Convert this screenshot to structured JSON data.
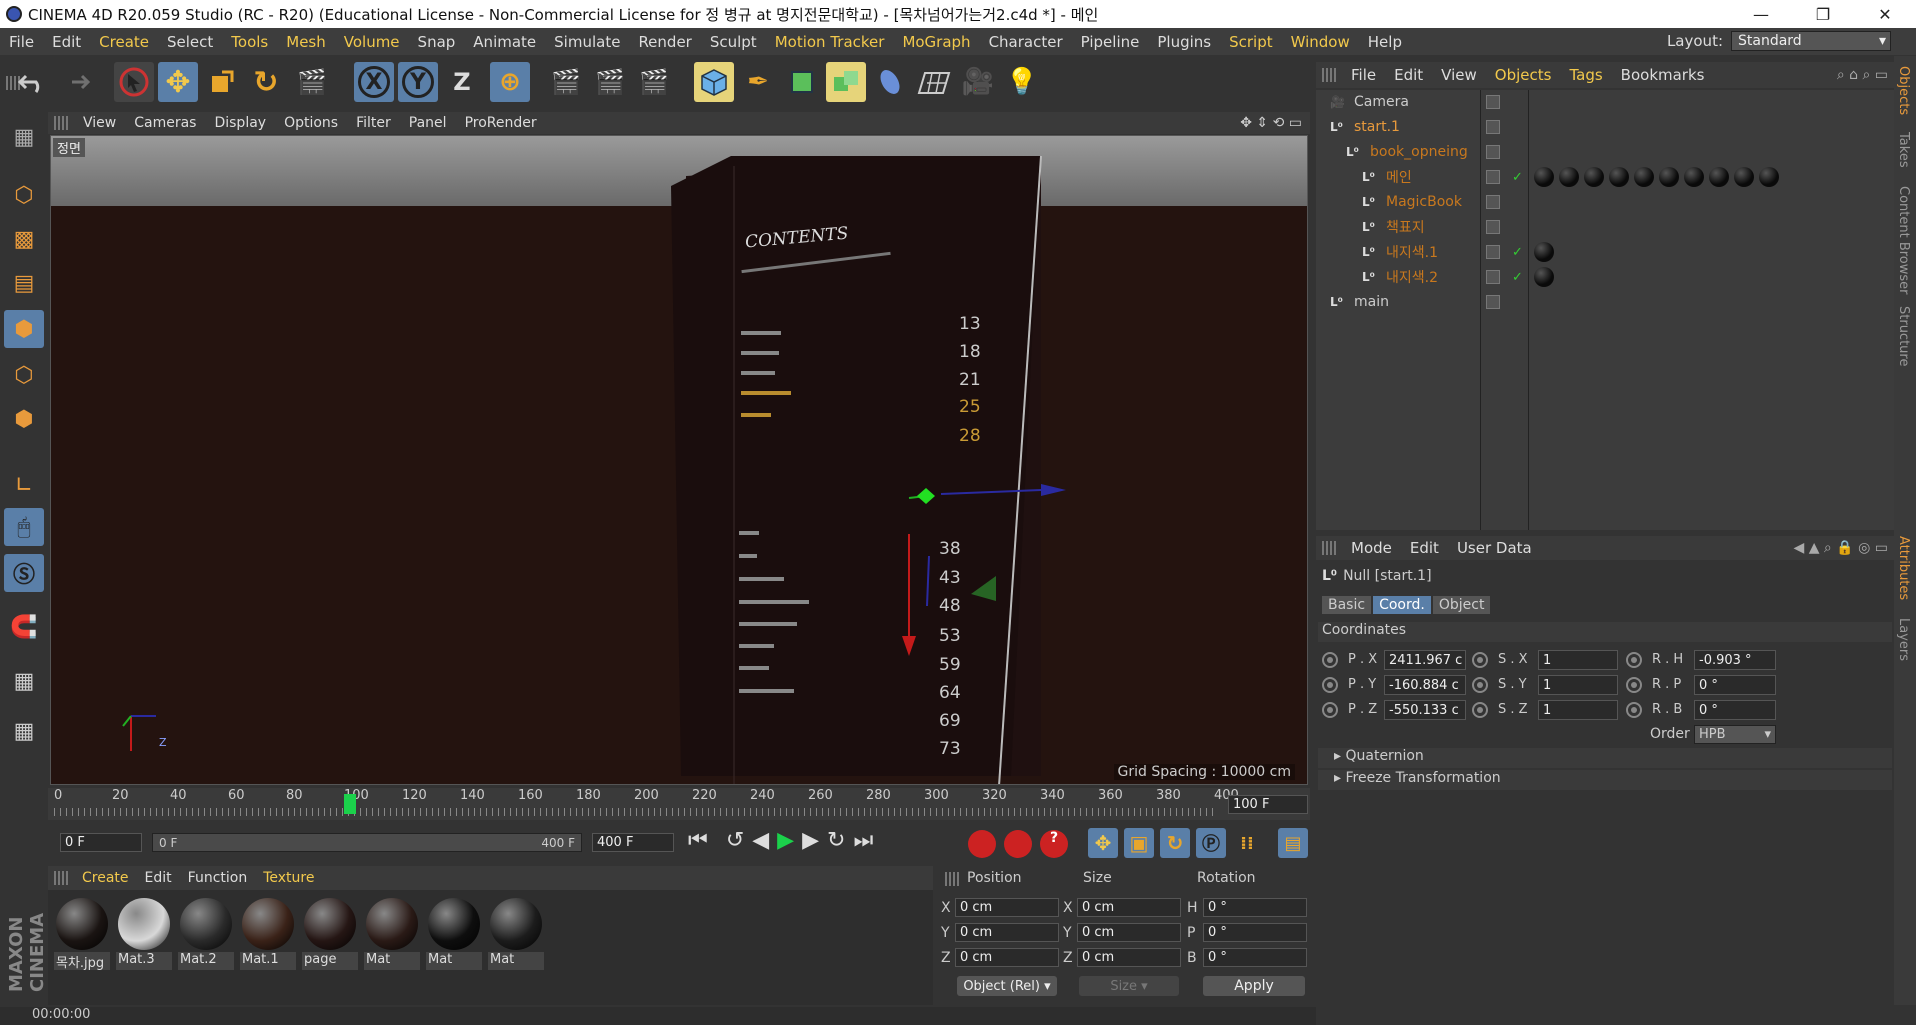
{
  "window": {
    "title": "CINEMA 4D R20.059 Studio (RC - R20) (Educational License - Non-Commercial License for 정 병규 at 명지전문대학교) - [목차넘어가는거2.c4d *] - 메인",
    "min": "—",
    "restore": "❐",
    "close": "✕"
  },
  "menu": {
    "items": [
      "File",
      "Edit",
      "Create",
      "Select",
      "Tools",
      "Mesh",
      "Volume",
      "Snap",
      "Animate",
      "Simulate",
      "Render",
      "Sculpt",
      "Motion Tracker",
      "MoGraph",
      "Character",
      "Pipeline",
      "Plugins",
      "Script",
      "Window",
      "Help"
    ],
    "layout_label": "Layout:",
    "layout_value": "Standard"
  },
  "toolbar": {
    "x": "X",
    "y": "Y",
    "z": "Z"
  },
  "viewport": {
    "menu": [
      "View",
      "Cameras",
      "Display",
      "Options",
      "Filter",
      "Panel",
      "ProRender"
    ],
    "camera_label": "정면",
    "grid_spacing": "Grid Spacing : 10000 cm",
    "book_title": "CONTENTS",
    "page_numbers": [
      "13",
      "18",
      "21",
      "25",
      "28",
      "38",
      "43",
      "48",
      "53",
      "59",
      "64",
      "69",
      "73"
    ],
    "axis_z": "Z"
  },
  "timeline": {
    "ticks": [
      "0",
      "20",
      "40",
      "60",
      "80",
      "100",
      "120",
      "140",
      "160",
      "180",
      "200",
      "220",
      "240",
      "260",
      "280",
      "300",
      "320",
      "340",
      "360",
      "380",
      "400"
    ],
    "current_frame": "100",
    "end_field": "100 F",
    "current_field": "0 F",
    "range_start": "0 F",
    "range_end": "400 F",
    "max_field": "400 F",
    "progress": 0.25
  },
  "materials": {
    "menu": [
      "Create",
      "Edit",
      "Function",
      "Texture"
    ],
    "items": [
      {
        "label": "목차.jpg",
        "color": "#1a1412"
      },
      {
        "label": "Mat.3",
        "color": "#d8d8d8"
      },
      {
        "label": "Mat.2",
        "color": "#2a2a2a"
      },
      {
        "label": "Mat.1",
        "color": "#3a2218"
      },
      {
        "label": "page",
        "color": "#251614"
      },
      {
        "label": "Mat",
        "color": "#2a1a16"
      },
      {
        "label": "Mat",
        "color": "#0e0e0e"
      },
      {
        "label": "Mat",
        "color": "#1c1c1c"
      }
    ]
  },
  "coords": {
    "position": "Position",
    "size": "Size",
    "rotation": "Rotation",
    "px": "0 cm",
    "py": "0 cm",
    "pz": "0 cm",
    "sx": "0 cm",
    "sy": "0 cm",
    "sz": "0 cm",
    "rh": "0 °",
    "rp": "0 °",
    "rb": "0 °",
    "lx": "X",
    "ly": "Y",
    "lz": "Z",
    "lh": "H",
    "lp": "P",
    "lb": "B",
    "mode": "Object (Rel)",
    "size_mode": "Size",
    "apply": "Apply"
  },
  "status": {
    "time": "00:00:00"
  },
  "objects": {
    "menu": [
      "File",
      "Edit",
      "View",
      "Objects",
      "Tags",
      "Bookmarks"
    ],
    "rows": [
      {
        "name": "Camera",
        "color": "#ccc",
        "indent": 0
      },
      {
        "name": "start.1",
        "color": "#e89a3c",
        "indent": 0
      },
      {
        "name": "book_opneing",
        "color": "#c8781e",
        "indent": 1
      },
      {
        "name": "메인",
        "color": "#c8781e",
        "indent": 2
      },
      {
        "name": "MagicBook",
        "color": "#c8781e",
        "indent": 2
      },
      {
        "name": "책표지",
        "color": "#c8781e",
        "indent": 2
      },
      {
        "name": "내지색.1",
        "color": "#c8781e",
        "indent": 2
      },
      {
        "name": "내지색.2",
        "color": "#c8781e",
        "indent": 2
      },
      {
        "name": "main",
        "color": "#ccc",
        "indent": 0
      }
    ]
  },
  "attributes": {
    "menu": [
      "Mode",
      "Edit",
      "User Data"
    ],
    "object": "Null [start.1]",
    "tabs": [
      "Basic",
      "Coord.",
      "Object"
    ],
    "section": "Coordinates",
    "px_l": "P . X",
    "py_l": "P . Y",
    "pz_l": "P . Z",
    "sx_l": "S . X",
    "sy_l": "S . Y",
    "sz_l": "S . Z",
    "rh_l": "R . H",
    "rp_l": "R . P",
    "rb_l": "R . B",
    "px": "2411.967 c",
    "py": "-160.884 c",
    "pz": "-550.133 c",
    "sx": "1",
    "sy": "1",
    "sz": "1",
    "rh": "-0.903 °",
    "rp": "0 °",
    "rb": "0 °",
    "order_label": "Order",
    "order": "HPB",
    "quaternion": "Quaternion",
    "freeze": "Freeze Transformation"
  },
  "right_tabs": [
    "Objects",
    "Takes",
    "Content Browser",
    "Structure",
    "Attributes",
    "Layers"
  ],
  "colors": {
    "accent": "#e89a3c",
    "active": "#5a7fa8"
  }
}
